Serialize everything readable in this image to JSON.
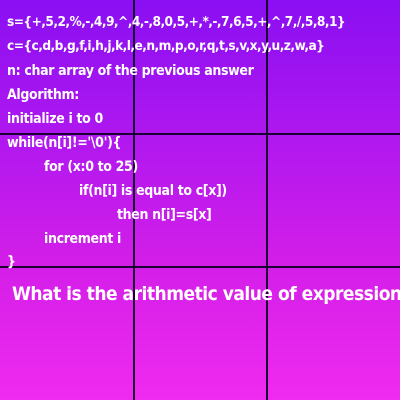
{
  "puzzle": {
    "lines": [
      "s={+,5,2,%,-,4,9,^,4,-,8,0,5,+,*,-,7,6,5,+,^,7,/,5,8,1}",
      "c={c,d,b,g,f,i,h,j,k,l,e,n,m,p,o,r,q,t,s,v,x,y,u,z,w,a}",
      "n: char array of the previous answer",
      "Algorithm:",
      "initialize i to 0",
      "while(n[i]!='\\0'){",
      "for (x:0 to 25)",
      "if(n[i] is equal to c[x])",
      "then n[i]=s[x]",
      "increment i",
      "}"
    ],
    "question": "What is the arithmetic value of expression?"
  },
  "colors": {
    "background_top": "#8a0ff2",
    "background_bottom": "#f02af0",
    "text": "#ffffff",
    "grid_lines": "#1a0033"
  }
}
